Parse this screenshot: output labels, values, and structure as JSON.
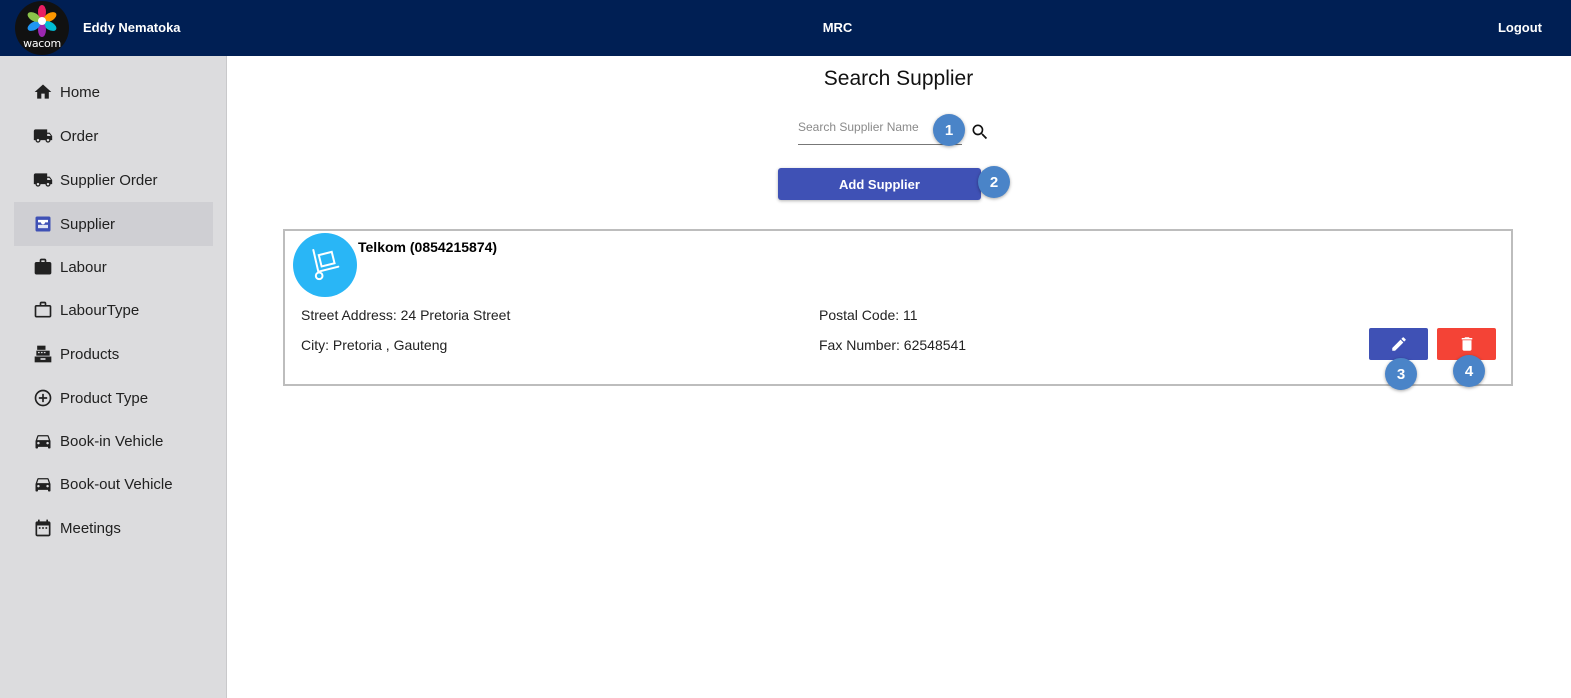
{
  "header": {
    "user_name": "Eddy Nematoka",
    "app_title": "MRC",
    "logout_label": "Logout",
    "logo_text": "wacom"
  },
  "sidebar": {
    "items": [
      {
        "label": "Home",
        "icon": "home-icon"
      },
      {
        "label": "Order",
        "icon": "truck-icon"
      },
      {
        "label": "Supplier Order",
        "icon": "truck-icon"
      },
      {
        "label": "Supplier",
        "icon": "inbox-icon",
        "active": true
      },
      {
        "label": "Labour",
        "icon": "briefcase-icon"
      },
      {
        "label": "LabourType",
        "icon": "briefcase-outline-icon"
      },
      {
        "label": "Products",
        "icon": "cash-register-icon"
      },
      {
        "label": "Product Type",
        "icon": "add-circle-icon"
      },
      {
        "label": "Book-in Vehicle",
        "icon": "car-icon"
      },
      {
        "label": "Book-out Vehicle",
        "icon": "car-icon"
      },
      {
        "label": "Meetings",
        "icon": "calendar-icon"
      }
    ]
  },
  "main": {
    "title": "Search Supplier",
    "search": {
      "placeholder": "Search Supplier Name",
      "value": ""
    },
    "add_label": "Add Supplier",
    "markers": [
      "1",
      "2",
      "3",
      "4"
    ]
  },
  "supplier": {
    "name": "Telkom (0854215874)",
    "street_address": "Street Address: 24 Pretoria Street",
    "city": "City: Pretoria , Gauteng",
    "postal_code": "Postal Code: 11",
    "fax_number": "Fax Number: 62548541"
  },
  "colors": {
    "header_bg": "#001f54",
    "sidebar_bg": "#dcdcde",
    "primary": "#3f51b5",
    "danger": "#f44336",
    "avatar": "#29b6f6",
    "marker": "#4a84c8"
  }
}
